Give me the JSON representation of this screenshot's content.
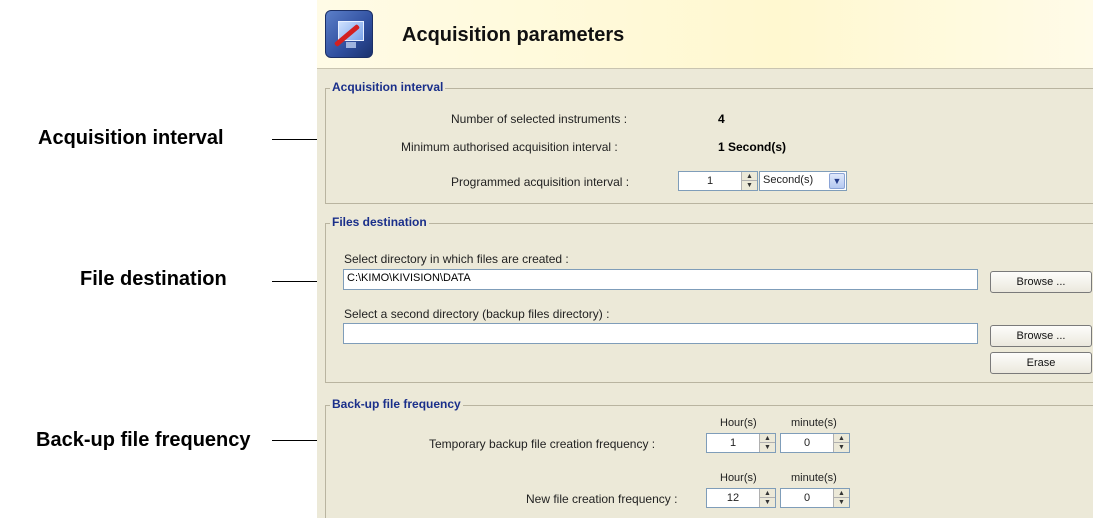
{
  "callouts": {
    "acquisition_interval": "Acquisition interval",
    "file_destination": "File destination",
    "backup_frequency": "Back-up file frequency"
  },
  "header": {
    "title": "Acquisition parameters",
    "icon": "monitor-tools-icon"
  },
  "acquisition": {
    "group_title": "Acquisition interval",
    "selected_label": "Number of selected instruments :",
    "selected_value": "4",
    "min_label": "Minimum authorised acquisition interval :",
    "min_value": "1 Second(s)",
    "programmed_label": "Programmed acquisition interval :",
    "programmed_value": "1",
    "unit_selected": "Second(s)"
  },
  "files": {
    "group_title": "Files destination",
    "dir_label": "Select directory in which files are created :",
    "dir_value": "C:\\KIMO\\KIVISION\\DATA",
    "backup_label": "Select a second directory (backup files directory) :",
    "backup_value": "",
    "browse_label": "Browse ...",
    "erase_label": "Erase"
  },
  "backup": {
    "group_title": "Back-up file frequency",
    "hours_head": "Hour(s)",
    "minutes_head": "minute(s)",
    "temp_label": "Temporary backup file creation frequency :",
    "temp_hours": "1",
    "temp_minutes": "0",
    "new_label": "New file creation frequency :",
    "new_hours": "12",
    "new_minutes": "0"
  }
}
